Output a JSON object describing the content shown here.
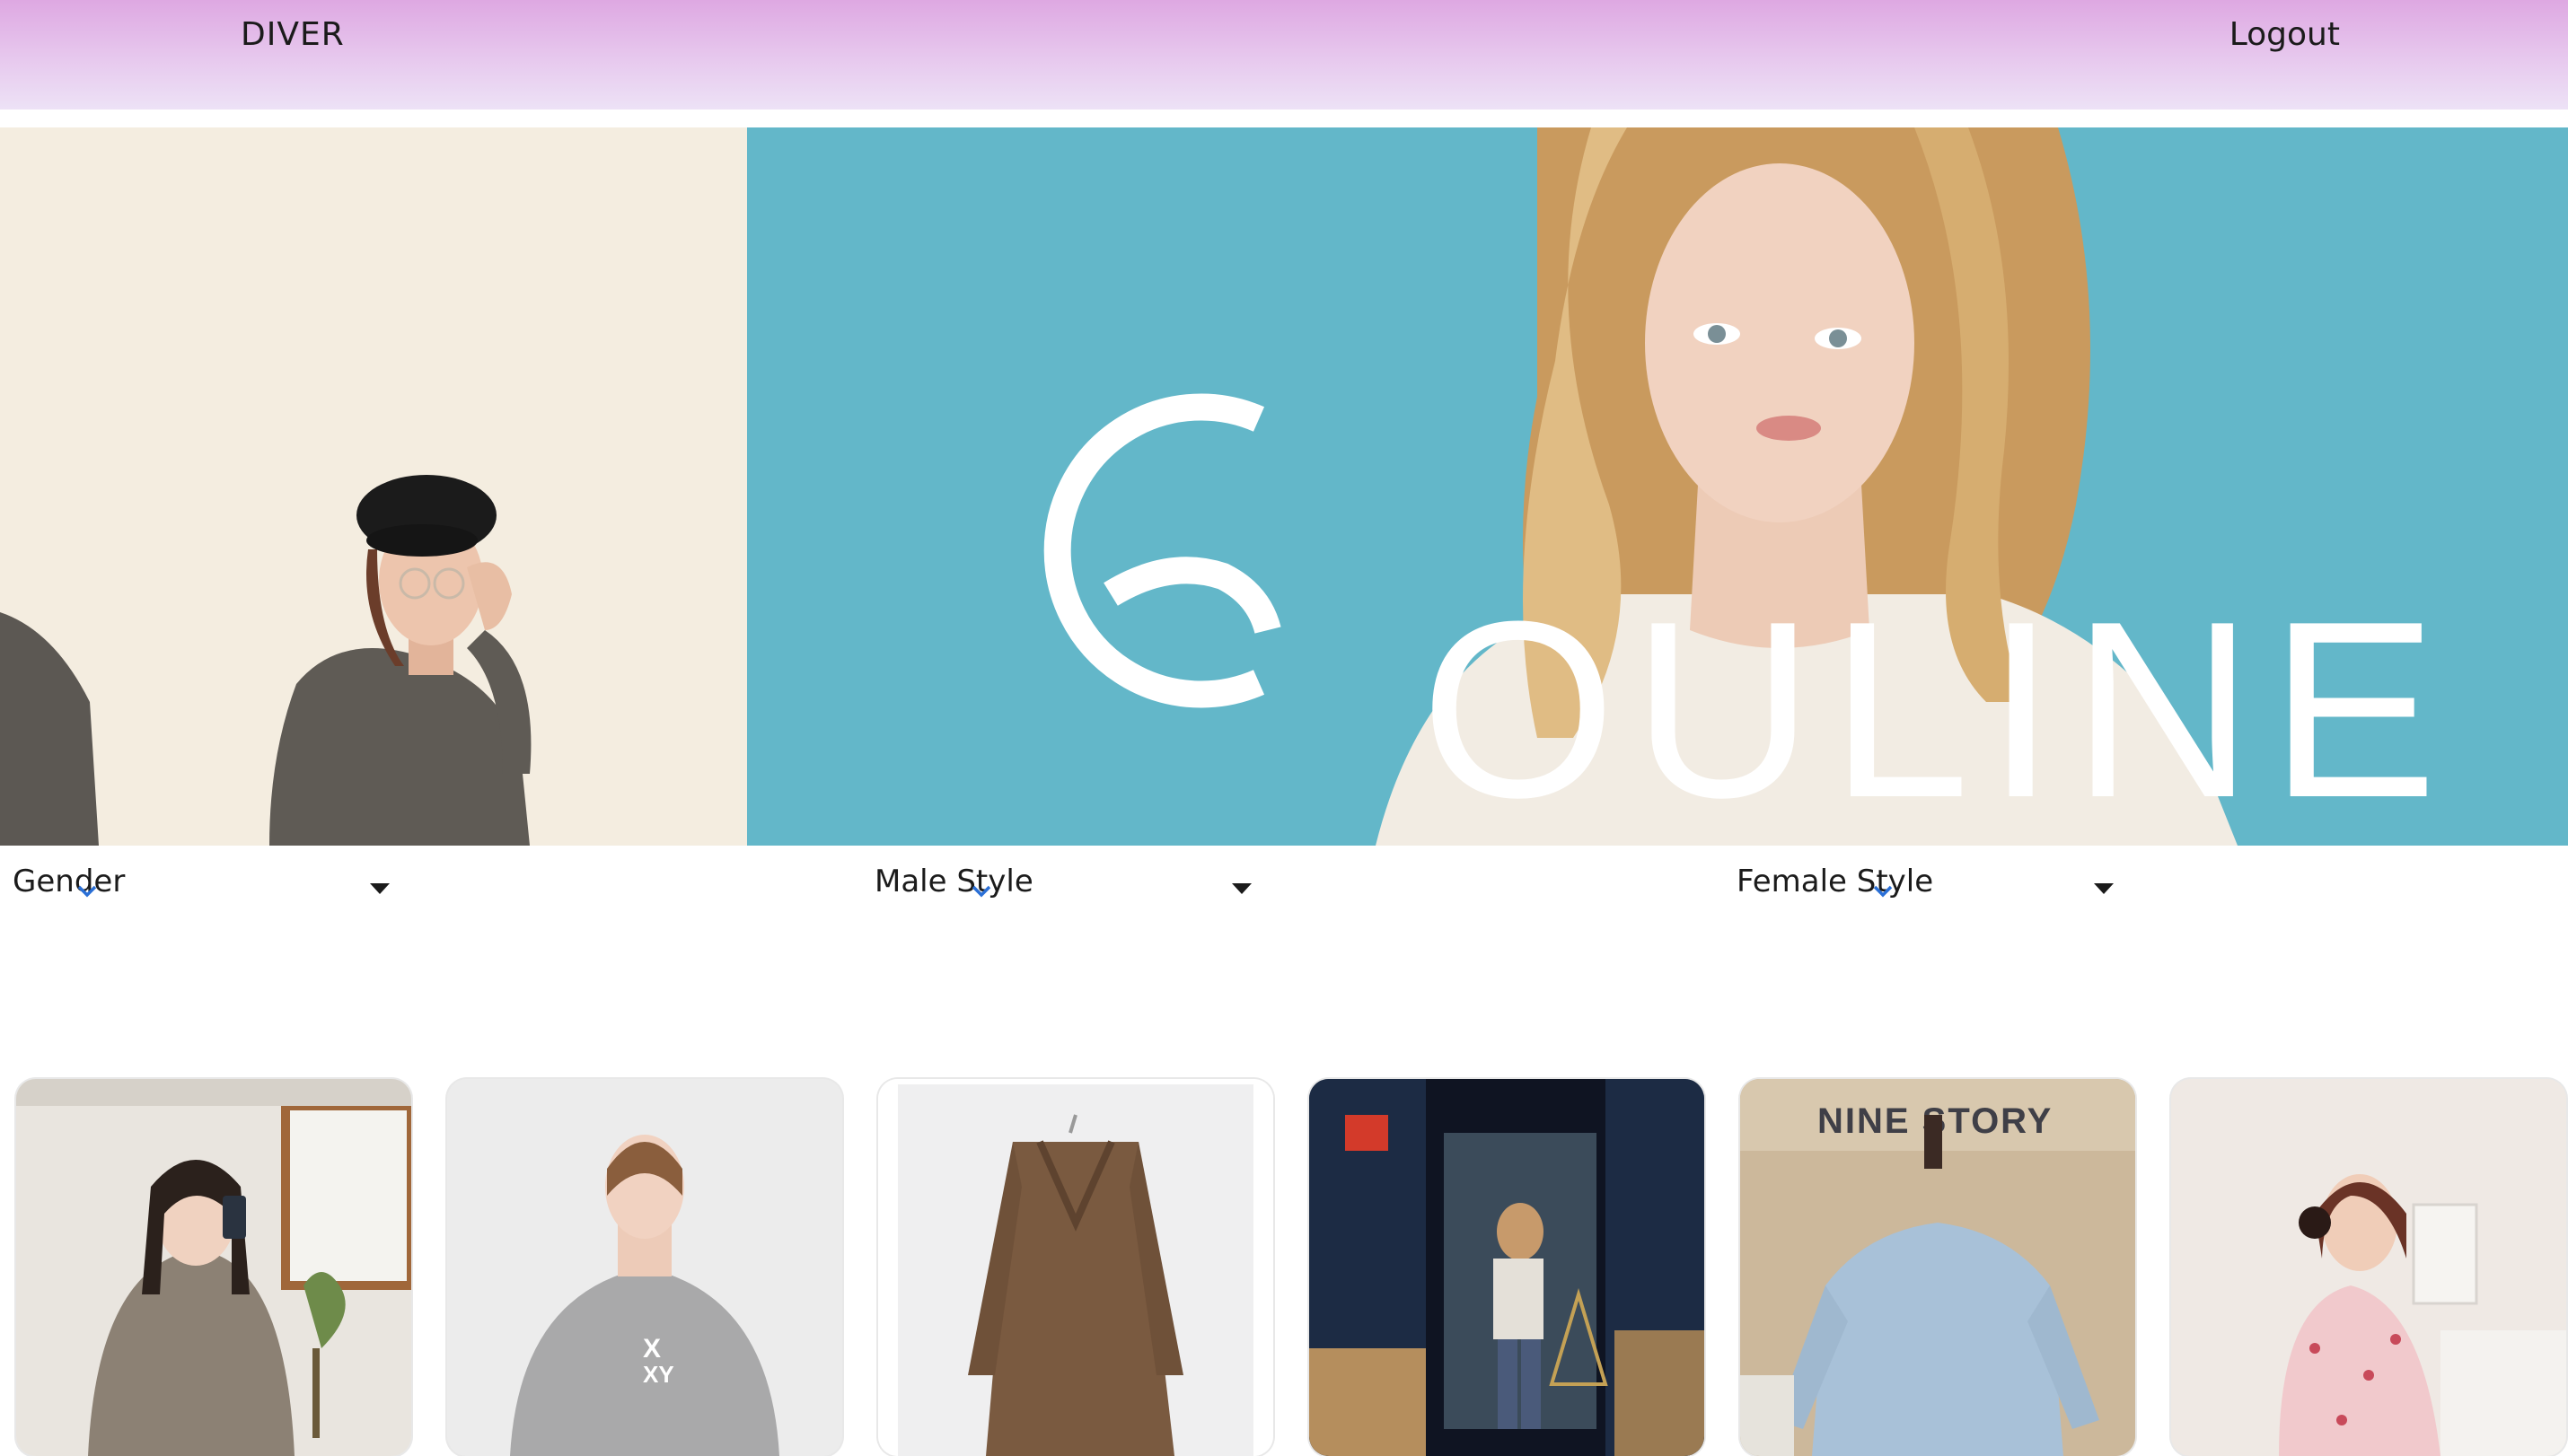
{
  "header": {
    "brand": "DIVER",
    "logout_label": "Logout"
  },
  "banner": {
    "brand_logo_text": "OULINE"
  },
  "filters": [
    {
      "label": "Gender"
    },
    {
      "label": "Male Style"
    },
    {
      "label": "Female Style"
    }
  ],
  "products": [
    {
      "description": "woman in knit wrap top"
    },
    {
      "description": "grey sweatshirt with XEXY print"
    },
    {
      "description": "brown wool coat on hanger"
    },
    {
      "description": "street mirror selfie"
    },
    {
      "description": "blue sweatshirt on mannequin"
    },
    {
      "description": "floral chiffon dress"
    }
  ],
  "colors": {
    "header_top": "#dea8e2",
    "header_bottom": "#ede2f6",
    "banner_teal": "#63b7c9",
    "banner_cream": "#f4ede0",
    "accent_check": "#2a6fd6"
  }
}
